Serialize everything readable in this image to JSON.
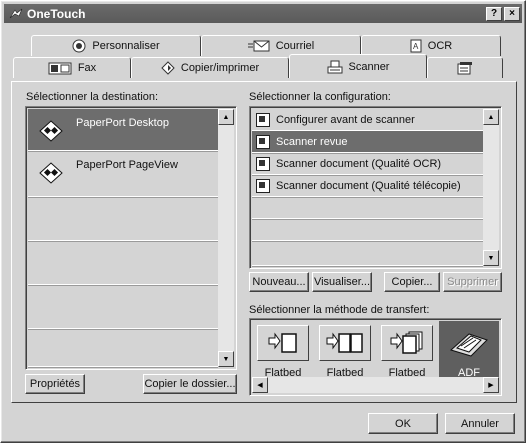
{
  "window": {
    "title": "OneTouch",
    "help_label": "?",
    "close_label": "×"
  },
  "tabs_top": [
    {
      "label": "Personnaliser",
      "icon": "radio-disc-icon"
    },
    {
      "label": "Courriel",
      "icon": "email-icon"
    },
    {
      "label": "OCR",
      "icon": "ocr-page-icon"
    }
  ],
  "tabs_bottom": [
    {
      "label": "Fax",
      "icon": "fax-icon"
    },
    {
      "label": "Copier/imprimer",
      "icon": "copy-print-icon"
    },
    {
      "label": "Scanner",
      "icon": "scanner-icon",
      "active": true
    },
    {
      "label": "",
      "icon": "properties-page-icon"
    }
  ],
  "destination": {
    "label": "Sélectionner la destination:",
    "items": [
      {
        "label": "PaperPort Desktop",
        "selected": true
      },
      {
        "label": "PaperPort PageView",
        "selected": false
      }
    ],
    "properties_button": "Propriétés",
    "copy_folder_button": "Copier le dossier..."
  },
  "configuration": {
    "label": "Sélectionner la configuration:",
    "items": [
      {
        "label": "Configurer avant de scanner",
        "selected": false
      },
      {
        "label": "Scanner revue",
        "selected": true
      },
      {
        "label": "Scanner document (Qualité OCR)",
        "selected": false
      },
      {
        "label": "Scanner document (Qualité télécopie)",
        "selected": false
      }
    ],
    "buttons": {
      "new": "Nouveau...",
      "view": "Visualiser...",
      "copy": "Copier...",
      "delete": "Supprimer"
    }
  },
  "transfer": {
    "label": "Sélectionner la méthode de transfert:",
    "options": [
      {
        "label": "Flatbed",
        "icon": "single-page-icon",
        "selected": false
      },
      {
        "label": "Flatbed",
        "icon": "two-page-icon",
        "selected": false
      },
      {
        "label": "Flatbed",
        "icon": "multi-page-icon",
        "selected": false
      },
      {
        "label": "ADF",
        "icon": "adf-feeder-icon",
        "selected": true
      }
    ]
  },
  "footer": {
    "ok": "OK",
    "cancel": "Annuler"
  },
  "colors": {
    "face": "#d4d4d4",
    "selection": "#6d6d6d",
    "title_bar": "#5f5f5f"
  }
}
